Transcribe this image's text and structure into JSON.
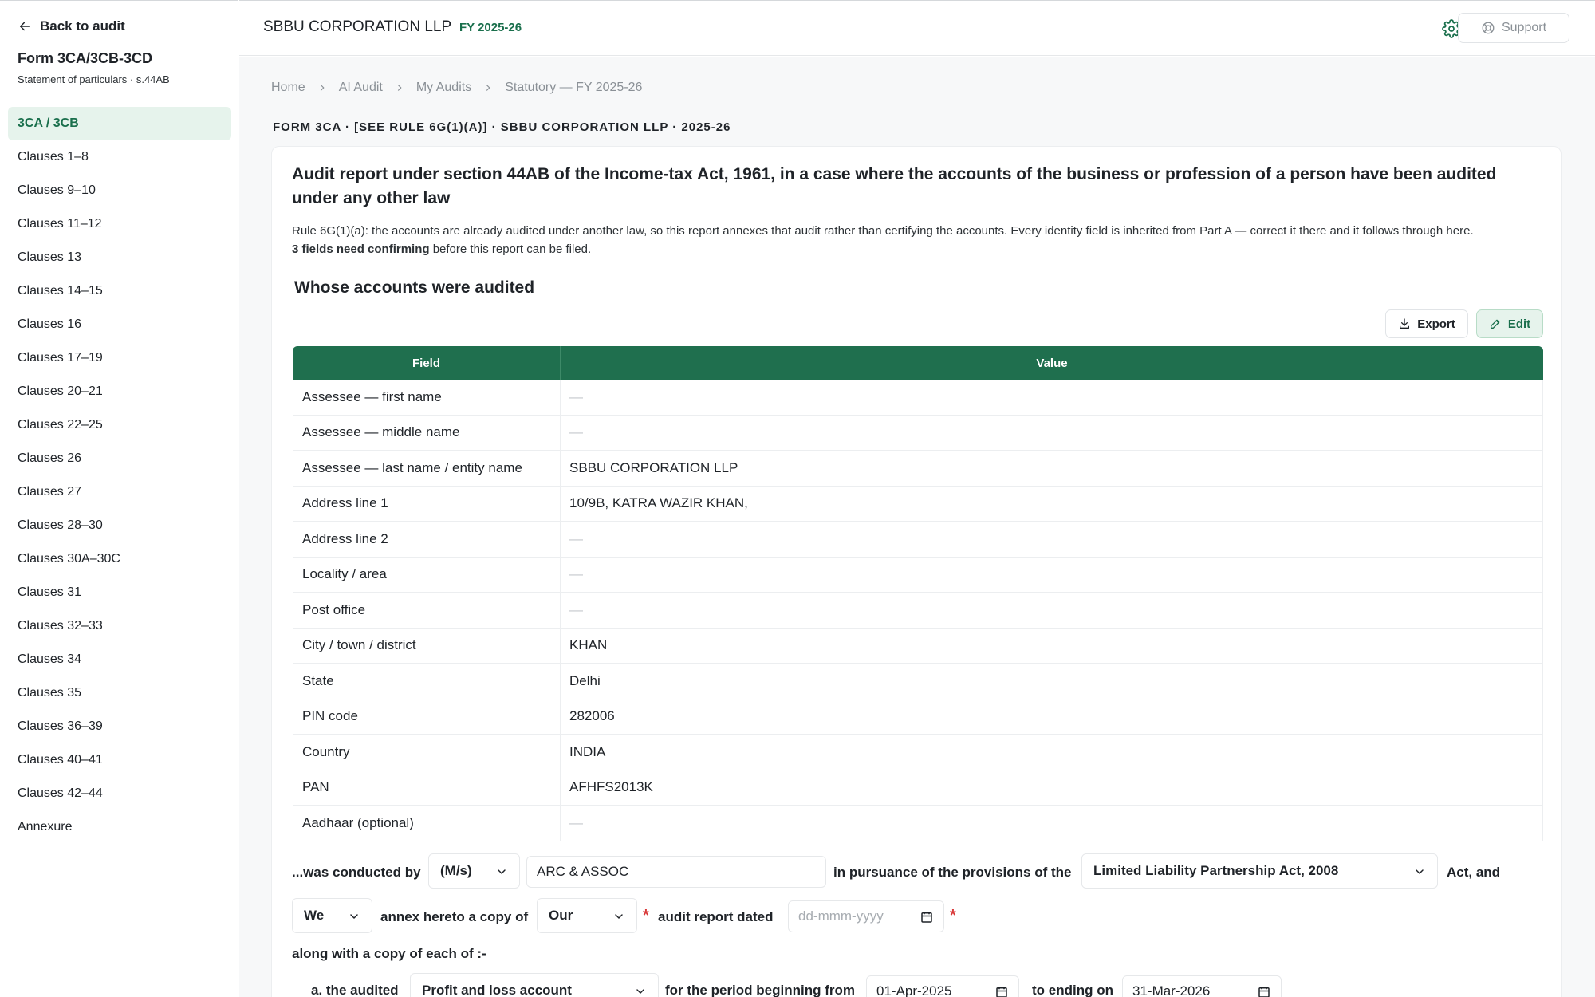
{
  "sidebar": {
    "back_label": "Back to audit",
    "form_title": "Form 3CA/3CB-3CD",
    "form_subtitle": "Statement of particulars · s.44AB",
    "items": [
      {
        "label": "3CA / 3CB",
        "active": true
      },
      {
        "label": "Clauses 1–8"
      },
      {
        "label": "Clauses 9–10"
      },
      {
        "label": "Clauses 11–12"
      },
      {
        "label": "Clauses 13"
      },
      {
        "label": "Clauses 14–15"
      },
      {
        "label": "Clauses 16"
      },
      {
        "label": "Clauses 17–19"
      },
      {
        "label": "Clauses 20–21"
      },
      {
        "label": "Clauses 22–25"
      },
      {
        "label": "Clauses 26"
      },
      {
        "label": "Clauses 27"
      },
      {
        "label": "Clauses 28–30"
      },
      {
        "label": "Clauses 30A–30C"
      },
      {
        "label": "Clauses 31"
      },
      {
        "label": "Clauses 32–33"
      },
      {
        "label": "Clauses 34"
      },
      {
        "label": "Clauses 35"
      },
      {
        "label": "Clauses 36–39"
      },
      {
        "label": "Clauses 40–41"
      },
      {
        "label": "Clauses 42–44"
      },
      {
        "label": "Annexure"
      }
    ]
  },
  "header": {
    "company": "SBBU CORPORATION LLP",
    "fy": "FY 2025-26",
    "support_label": "Support",
    "settings_icon": "gear-icon",
    "support_icon": "lifebuoy-icon"
  },
  "breadcrumb": [
    "Home",
    "AI Audit",
    "My Audits",
    "Statutory — FY 2025-26"
  ],
  "form_line": "FORM 3CA · [SEE RULE 6G(1)(A)] · SBBU CORPORATION LLP · 2025-26",
  "card": {
    "title": "Audit report under section 44AB of the Income-tax Act, 1961, in a case where the accounts of the business or profession of a person have been audited under any other law",
    "description": "Rule 6G(1)(a): the accounts are already audited under another law, so this report annexes that audit rather than certifying the accounts. Every identity field is inherited from Part A — correct it there and it follows through here.",
    "confirm_count": "3 fields need confirming",
    "confirm_suffix": " before this report can be filed.",
    "section_title": "Whose accounts were audited",
    "export_label": "Export",
    "edit_label": "Edit"
  },
  "table": {
    "headers": [
      "Field",
      "Value"
    ],
    "rows": [
      [
        "Assessee — first name",
        "—"
      ],
      [
        "Assessee — middle name",
        "—"
      ],
      [
        "Assessee — last name / entity name",
        "SBBU CORPORATION LLP"
      ],
      [
        "Address line 1",
        "10/9B, KATRA WAZIR KHAN,"
      ],
      [
        "Address line 2",
        "—"
      ],
      [
        "Locality / area",
        "—"
      ],
      [
        "Post office",
        "—"
      ],
      [
        "City / town / district",
        "KHAN"
      ],
      [
        "State",
        "Delhi"
      ],
      [
        "PIN code",
        "282006"
      ],
      [
        "Country",
        "INDIA"
      ],
      [
        "PAN",
        "AFHFS2013K"
      ],
      [
        "Aadhaar (optional)",
        "—"
      ]
    ]
  },
  "sentence": {
    "conducted_by": "...was conducted by",
    "ms_value": "(M/s)",
    "firm_value": "ARC & ASSOC",
    "pursuance": "in pursuance of the provisions of the",
    "act_value": "Limited Liability Partnership Act, 2008",
    "act_and": "Act, and",
    "we_value": "We",
    "annex": "annex hereto a copy of",
    "our_value": "Our",
    "report_dated": "audit report dated",
    "date_placeholder": "dd-mmm-yyyy",
    "along_with": "along with a copy of each of :-",
    "a_audited": "a. the audited",
    "pl_value": "Profit and loss account",
    "period_from": "for the period beginning from",
    "from_date": "01-Apr-2025",
    "to_ending": "to ending on",
    "to_date": "31-Mar-2026"
  }
}
